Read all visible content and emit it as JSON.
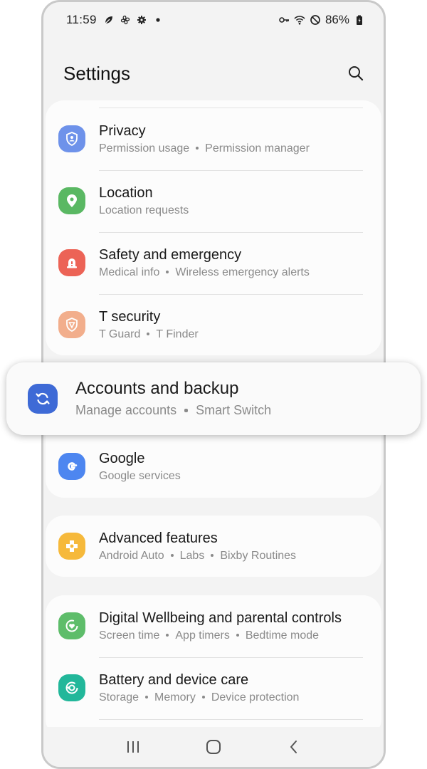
{
  "status_bar": {
    "time": "11:59",
    "left_icons": [
      "leaf-icon",
      "fan-icon",
      "gear-icon",
      "dot-icon"
    ],
    "right_icons": [
      "key-icon",
      "wifi-icon",
      "do-not-disturb-icon",
      "battery-icon"
    ],
    "battery": "86%"
  },
  "header": {
    "title": "Settings",
    "search_icon": "search-icon"
  },
  "cards": {
    "card1": {
      "items": [
        {
          "title": "Privacy",
          "subs": [
            "Permission usage",
            "Permission manager"
          ],
          "icon": "privacy-shield-icon",
          "color": "#6e92ea"
        },
        {
          "title": "Location",
          "subs": [
            "Location requests"
          ],
          "icon": "location-pin-icon",
          "color": "#5ab863"
        },
        {
          "title": "Safety and emergency",
          "subs": [
            "Medical info",
            "Wireless emergency alerts"
          ],
          "icon": "emergency-alert-icon",
          "color": "#ec6356"
        },
        {
          "title": "T security",
          "subs": [
            "T Guard",
            "T Finder"
          ],
          "icon": "t-security-icon",
          "color": "#f2ae8c"
        }
      ]
    },
    "highlight": {
      "title": "Accounts and backup",
      "subs": [
        "Manage accounts",
        "Smart Switch"
      ],
      "icon": "sync-icon",
      "color": "#3e6ad6"
    },
    "card2": {
      "items": [
        {
          "title": "Google",
          "subs": [
            "Google services"
          ],
          "icon": "google-icon",
          "color": "#4d86f0"
        }
      ]
    },
    "card3": {
      "items": [
        {
          "title": "Advanced features",
          "subs": [
            "Android Auto",
            "Labs",
            "Bixby Routines"
          ],
          "icon": "advanced-features-icon",
          "color": "#f6b93b"
        }
      ]
    },
    "card4": {
      "items": [
        {
          "title": "Digital Wellbeing and parental controls",
          "subs": [
            "Screen time",
            "App timers",
            "Bedtime mode"
          ],
          "icon": "wellbeing-heart-icon",
          "color": "#5ebd6a"
        },
        {
          "title": "Battery and device care",
          "subs": [
            "Storage",
            "Memory",
            "Device protection"
          ],
          "icon": "device-care-icon",
          "color": "#22b79a"
        }
      ]
    }
  },
  "navbar": {
    "buttons": [
      "recent-apps-icon",
      "home-icon",
      "back-icon"
    ]
  }
}
